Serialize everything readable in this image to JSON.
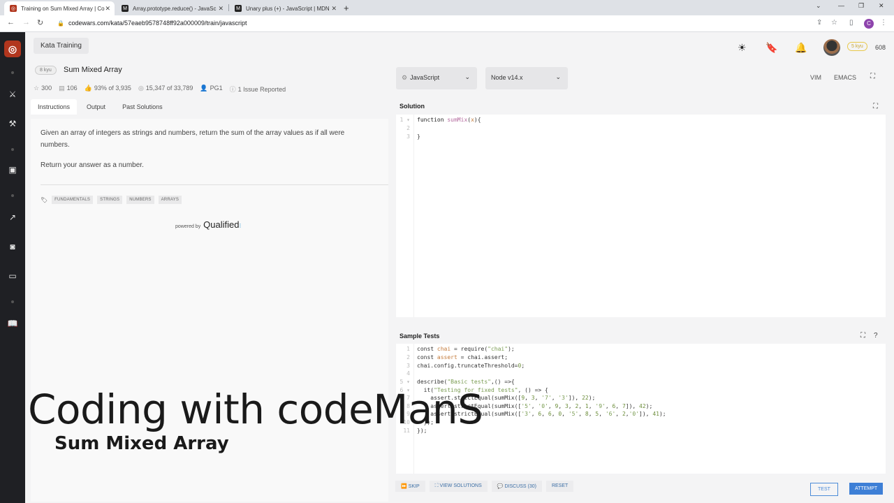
{
  "browser": {
    "tabs": [
      {
        "label": "Training on Sum Mixed Array | Co",
        "favicon": "codewars-icon"
      },
      {
        "label": "Array.prototype.reduce() - JavaSc",
        "favicon": "mdn-icon"
      },
      {
        "label": "Unary plus (+) - JavaScript | MDN",
        "favicon": "mdn-icon"
      }
    ],
    "url": "codewars.com/kata/57eaeb9578748ff92a000009/train/javascript",
    "profile_initial": "C"
  },
  "header": {
    "kata_training": "Kata Training",
    "kyu_badge": "5 kyu",
    "honor": "608"
  },
  "kata": {
    "kyu": "8 kyu",
    "title": "Sum Mixed Array",
    "stats": {
      "stars": "300",
      "collections": "106",
      "satisfaction_pct": "93%",
      "satisfaction_of": "of 3,935",
      "completed": "15,347",
      "completed_of": "of 33,789",
      "rank": "PG1",
      "issues": "1 Issue Reported"
    },
    "tabs": [
      "Instructions",
      "Output",
      "Past Solutions"
    ],
    "description": [
      "Given an array of integers as strings and numbers, return the sum of the array values as if all were numbers.",
      "Return your answer as a number."
    ],
    "tags": [
      "FUNDAMENTALS",
      "STRINGS",
      "NUMBERS",
      "ARRAYS"
    ],
    "powered_by": "powered by",
    "powered_brand": "Qualified"
  },
  "editor": {
    "language": "JavaScript",
    "runtime": "Node v14.x",
    "modes": [
      "VIM",
      "EMACS"
    ],
    "solution_title": "Solution",
    "sample_tests_title": "Sample Tests"
  },
  "actions": {
    "skip": "SKIP",
    "view_solutions": "VIEW SOLUTIONS",
    "discuss": "DISCUSS (30)",
    "reset": "RESET",
    "test": "TEST",
    "attempt": "ATTEMPT"
  },
  "overlay": {
    "title": "Coding with codeManS",
    "subtitle": "Sum Mixed Array"
  },
  "colors": {
    "brand": "#b1361e",
    "rail": "#1f2024",
    "attempt": "#3d7fd6"
  }
}
